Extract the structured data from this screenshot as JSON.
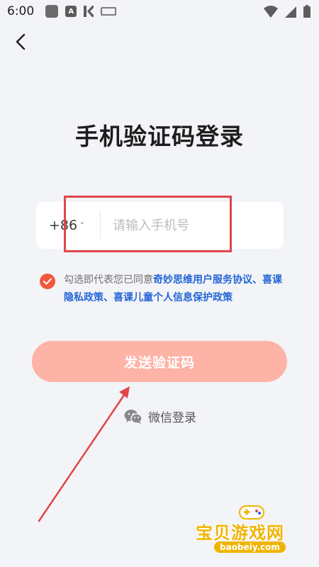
{
  "status_bar": {
    "time": "6:00",
    "app_icon_letter": "A"
  },
  "title": "手机验证码登录",
  "phone": {
    "country_code": "+86",
    "chevron": "˅",
    "placeholder": "请输入手机号",
    "value": ""
  },
  "agreement": {
    "checked": true,
    "prefix": "勾选即代表您已同意",
    "link1": "奇妙思维用户服务协议",
    "sep1": "、",
    "link2": "喜课隐私政策",
    "sep2": "、",
    "link3": "喜课儿童个人信息保护政策"
  },
  "send_code_label": "发送验证码",
  "wechat_login_label": "微信登录",
  "watermark": {
    "text": "宝贝游戏网",
    "url": "baobeiy.com"
  },
  "colors": {
    "background": "#f3f4f8",
    "accent": "#f05a3c",
    "button": "#fdb3a6",
    "link": "#2365d6",
    "annotation": "#e0464a"
  },
  "icons": {
    "back": "back-arrow-icon",
    "wechat": "wechat-icon",
    "checkbox": "checkmark-icon"
  }
}
